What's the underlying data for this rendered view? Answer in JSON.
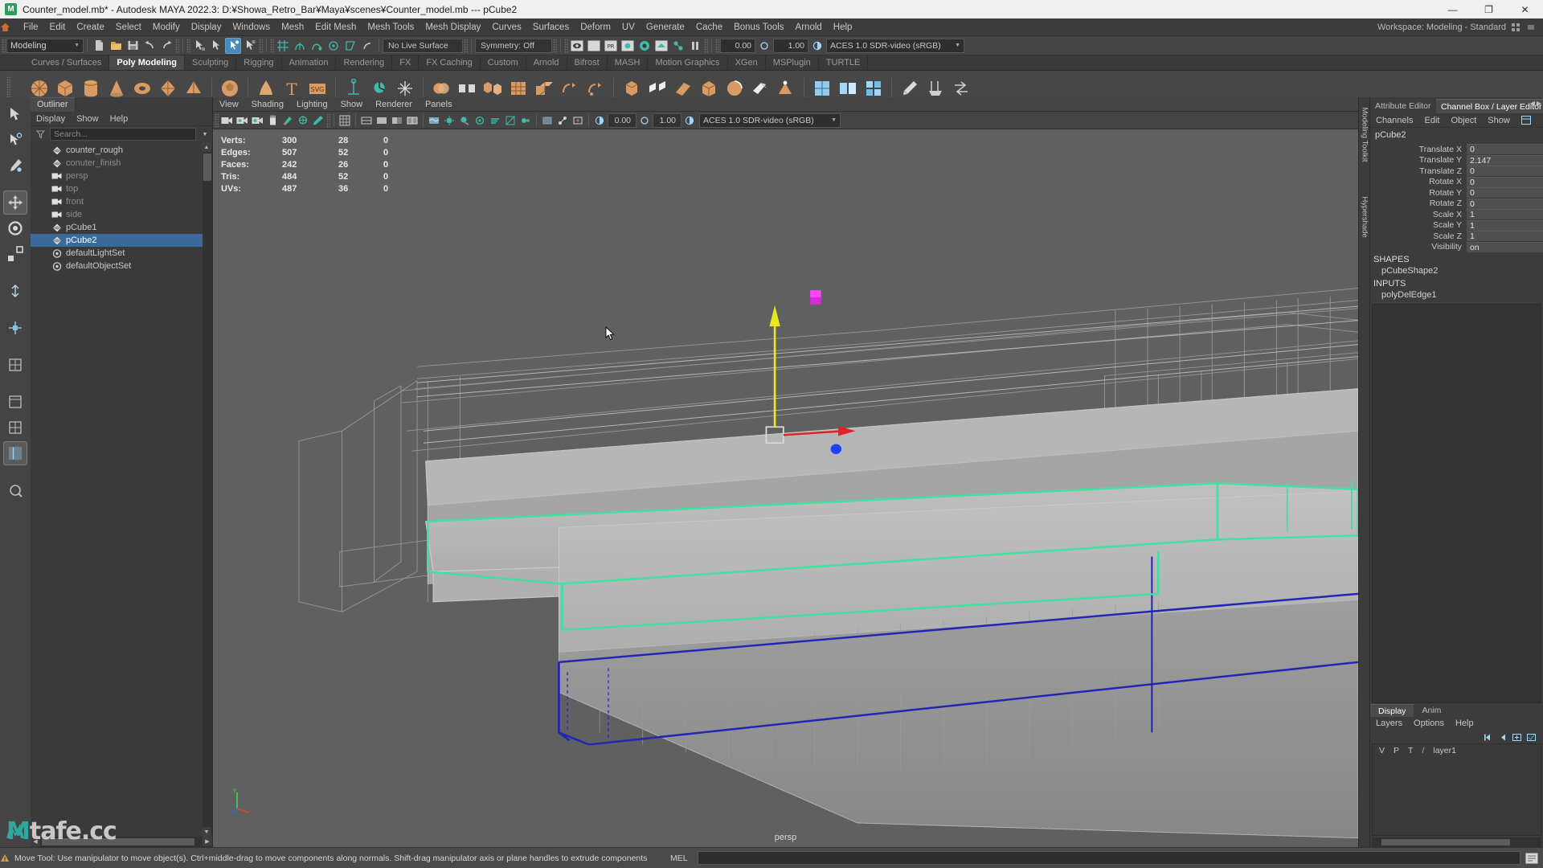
{
  "window": {
    "title": "Counter_model.mb* - Autodesk MAYA 2022.3: D:¥Showa_Retro_Bar¥Maya¥scenes¥Counter_model.mb   ---   pCube2",
    "logo_letter": "M",
    "minimize": "—",
    "maximize": "❐",
    "close": "✕"
  },
  "menubar": {
    "home_icon": "home-icon",
    "items": [
      "File",
      "Edit",
      "Create",
      "Select",
      "Modify",
      "Display",
      "Windows",
      "Mesh",
      "Edit Mesh",
      "Mesh Tools",
      "Mesh Display",
      "Curves",
      "Surfaces",
      "Deform",
      "UV",
      "Generate",
      "Cache",
      "Bonus Tools",
      "Arnold",
      "Help"
    ],
    "workspace_label": "Workspace: Modeling - Standard"
  },
  "statusline": {
    "mode": "Modeling",
    "live_surface": "No Live Surface",
    "symmetry": "Symmetry: Off",
    "num_left": "0.00",
    "num_right": "1.00",
    "color_space": "ACES 1.0 SDR-video (sRGB)"
  },
  "shelf": {
    "tabs": [
      "Curves / Surfaces",
      "Poly Modeling",
      "Sculpting",
      "Rigging",
      "Animation",
      "Rendering",
      "FX",
      "FX Caching",
      "Custom",
      "Arnold",
      "Bifrost",
      "MASH",
      "Motion Graphics",
      "XGen",
      "MSPlugin",
      "TURTLE"
    ],
    "active_tab": "Poly Modeling"
  },
  "outliner": {
    "tab_label": "Outliner",
    "menu": [
      "Display",
      "Show",
      "Help"
    ],
    "search_placeholder": "Search...",
    "items": [
      {
        "label": "counter_rough",
        "icon": "mesh-icon",
        "state": "normal",
        "indent": 0
      },
      {
        "label": "conuter_finish",
        "icon": "mesh-icon",
        "state": "dim",
        "indent": 0
      },
      {
        "label": "persp",
        "icon": "camera-icon",
        "state": "dim",
        "indent": 0
      },
      {
        "label": "top",
        "icon": "camera-icon",
        "state": "dim",
        "indent": 0
      },
      {
        "label": "front",
        "icon": "camera-icon",
        "state": "dim",
        "indent": 0
      },
      {
        "label": "side",
        "icon": "camera-icon",
        "state": "dim",
        "indent": 0
      },
      {
        "label": "pCube1",
        "icon": "mesh-icon",
        "state": "normal",
        "indent": 0
      },
      {
        "label": "pCube2",
        "icon": "mesh-icon",
        "state": "selected",
        "indent": 0
      },
      {
        "label": "defaultLightSet",
        "icon": "set-icon",
        "state": "normal",
        "indent": 0
      },
      {
        "label": "defaultObjectSet",
        "icon": "set-icon",
        "state": "normal",
        "indent": 0
      }
    ]
  },
  "viewport": {
    "menu": [
      "View",
      "Shading",
      "Lighting",
      "Show",
      "Renderer",
      "Panels"
    ],
    "camera_label": "persp",
    "hud": {
      "headers": [
        "",
        "",
        "",
        ""
      ],
      "rows": [
        {
          "label": "Verts:",
          "total": "300",
          "sel": "28",
          "extra": "0"
        },
        {
          "label": "Edges:",
          "total": "507",
          "sel": "52",
          "extra": "0"
        },
        {
          "label": "Faces:",
          "total": "242",
          "sel": "26",
          "extra": "0"
        },
        {
          "label": "Tris:",
          "total": "484",
          "sel": "52",
          "extra": "0"
        },
        {
          "label": "UVs:",
          "total": "487",
          "sel": "36",
          "extra": "0"
        }
      ]
    },
    "axis": {
      "x": "x",
      "y": "y",
      "z": "z"
    }
  },
  "sidebar_vertical_tabs": [
    "Modeling Toolkit",
    "Hypershade"
  ],
  "channelbox": {
    "tabs": [
      "Attribute Editor",
      "Channel Box / Layer Editor"
    ],
    "active_tab": "Channel Box / Layer Editor",
    "menu": [
      "Channels",
      "Edit",
      "Object",
      "Show"
    ],
    "object_name": "pCube2",
    "attributes": [
      {
        "name": "Translate X",
        "value": "0"
      },
      {
        "name": "Translate Y",
        "value": "2.147"
      },
      {
        "name": "Translate Z",
        "value": "0"
      },
      {
        "name": "Rotate X",
        "value": "0"
      },
      {
        "name": "Rotate Y",
        "value": "0"
      },
      {
        "name": "Rotate Z",
        "value": "0"
      },
      {
        "name": "Scale X",
        "value": "1"
      },
      {
        "name": "Scale Y",
        "value": "1"
      },
      {
        "name": "Scale Z",
        "value": "1"
      },
      {
        "name": "Visibility",
        "value": "on"
      }
    ],
    "shapes_header": "SHAPES",
    "shapes": [
      "pCubeShape2"
    ],
    "inputs_header": "INPUTS",
    "inputs": [
      "polyDelEdge1"
    ]
  },
  "layereditor": {
    "tabs": [
      "Display",
      "Anim"
    ],
    "active_tab": "Display",
    "menu": [
      "Layers",
      "Options",
      "Help"
    ],
    "columns": [
      "V",
      "P",
      "T"
    ],
    "layers": [
      {
        "name": "layer1",
        "v": "V",
        "p": "P",
        "t": "T"
      }
    ]
  },
  "statusbar": {
    "help_text": "Move Tool: Use manipulator to move object(s). Ctrl+middle-drag to move components along normals. Shift-drag manipulator axis or plane handles to extrude components or clone objects. Ctrl+Shift+drag to cons",
    "mel_label": "MEL",
    "command_value": ""
  },
  "watermark": {
    "text_left": "",
    "text_m": "M",
    "text_right": "tafe.cc"
  },
  "colors": {
    "accent_blue": "#4a89b8",
    "selected_row": "#3a6a9a",
    "selection_green": "#41e0a3",
    "highlight_blue": "#2020c0",
    "manip_red": "#e02020",
    "manip_green": "#20e020",
    "manip_blue": "#2040ff",
    "teal_icon": "#2fa8a0",
    "shelf_orange": "#d59a66",
    "viewport_bg": "#606060"
  }
}
